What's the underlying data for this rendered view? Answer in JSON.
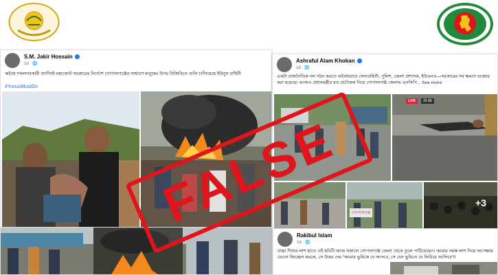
{
  "colors": {
    "stamp": "#e0141b",
    "link": "#216fdb",
    "verified": "#1877f2",
    "live": "#e41e3f"
  },
  "logos": {
    "left": "bangladesh-government-emblem",
    "right": "bangladesh-map-emblem"
  },
  "posts": [
    {
      "author": "S.M. Jakir Hossain",
      "meta": "1d · 🌐",
      "text": "অবৈধ দখলদারকারী ফ্যাসিস্ট মহাজোট সরকারের নির্দেশে গোপালগঞ্জের সাধারণ মানুষের উপর বিজিবিতে গুলি চালিয়েছে ইউনুস বাহিনী",
      "hashtag": "#YunusMustGo"
    },
    {
      "author": "Ashraful Alam Khokan",
      "meta": "1d · 🌐",
      "text": "একটা রাজনৈতিক দল গঠন করতে অবৈধভাবে সেনাবাহিনী, পুলিশ, জেলা প্রশাসক, ইউএনও—সরকারের সব ক্ষমতা ব্যবহার করা হয়েছে। আজও প্রধানমন্ত্রীর মত প্রটোকল নিয়ে গোপালগঞ্জ জেলায় এনসিপি...",
      "see_more": "See more",
      "live_label": "LIVE",
      "view_count": "35.8K",
      "more_photos": "+3",
      "sign_text": "গোপালগঞ্জ"
    },
    {
      "author": "Rakibul Islam",
      "meta": "1d · 🌐",
      "text": "বাচ্চা শিশুর লাশ হাতে এই ছবিটি আজ সকালে গোপালগঞ্জ জেলা থেকে তুলে পাঠিয়েছেন। আমার সমস্ত লাশ নিয়ে অপেক্ষায় যেতো জিজ্ঞেস করলে, সে উত্তর দেয় \"আমার ভুমিকে যে আসবে, সে যেন ভুমিতে যে ফিরিয়ে আসিবে\"!!"
    }
  ],
  "stamp": {
    "text": "FALSE"
  }
}
